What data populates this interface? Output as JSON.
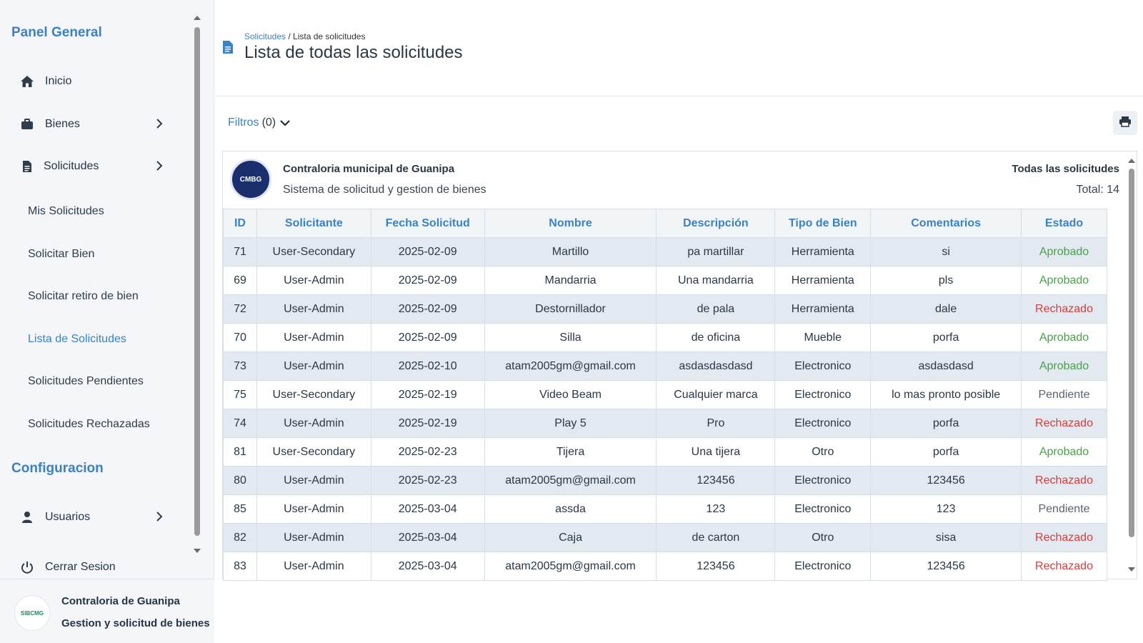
{
  "sidebar": {
    "panel_title": "Panel General",
    "items": [
      {
        "label": "Inicio",
        "icon": "home-icon"
      },
      {
        "label": "Bienes",
        "icon": "briefcase-icon"
      },
      {
        "label": "Solicitudes",
        "icon": "document-icon"
      }
    ],
    "sub_items": [
      "Mis Solicitudes",
      "Solicitar Bien",
      "Solicitar retiro de bien",
      "Lista de Solicitudes",
      "Solicitudes Pendientes",
      "Solicitudes Rechazadas"
    ],
    "active_sub": "Lista de Solicitudes",
    "config_title": "Configuracion",
    "usuarios_label": "Usuarios",
    "partial_label": "Cerrar Sesion",
    "footer": {
      "logo_text": "SIBCMG",
      "title": "Contraloria de Guanipa",
      "subtitle": "Gestion y solicitud de bienes"
    }
  },
  "header": {
    "breadcrumb_link": "Solicitudes",
    "breadcrumb_sep": " / ",
    "breadcrumb_current": "Lista de solicitudes",
    "title": "Lista de todas las solicitudes"
  },
  "toolbar": {
    "filters_label": "Filtros",
    "filters_count": "(0)"
  },
  "report": {
    "logo_text": "CMBG",
    "org_name": "Contraloria municipal de Guanipa",
    "org_subtitle": "Sistema de solicitud y gestion de bienes",
    "title": "Todas las solicitudes",
    "total": "Total: 14"
  },
  "table": {
    "columns": [
      "ID",
      "Solicitante",
      "Fecha Solicitud",
      "Nombre",
      "Descripción",
      "Tipo de Bien",
      "Comentarios",
      "Estado"
    ],
    "rows": [
      [
        "71",
        "User-Secondary",
        "2025-02-09",
        "Martillo",
        "pa martillar",
        "Herramienta",
        "si",
        "Aprobado"
      ],
      [
        "69",
        "User-Admin",
        "2025-02-09",
        "Mandarria",
        "Una mandarria",
        "Herramienta",
        "pls",
        "Aprobado"
      ],
      [
        "72",
        "User-Admin",
        "2025-02-09",
        "Destornillador",
        "de pala",
        "Herramienta",
        "dale",
        "Rechazado"
      ],
      [
        "70",
        "User-Admin",
        "2025-02-09",
        "Silla",
        "de oficina",
        "Mueble",
        "porfa",
        "Aprobado"
      ],
      [
        "73",
        "User-Admin",
        "2025-02-10",
        "atam2005gm@gmail.com",
        "asdasdasdasd",
        "Electronico",
        "asdasdasd",
        "Aprobado"
      ],
      [
        "75",
        "User-Secondary",
        "2025-02-19",
        "Video Beam",
        "Cualquier marca",
        "Electronico",
        "lo mas pronto posible",
        "Pendiente"
      ],
      [
        "74",
        "User-Admin",
        "2025-02-19",
        "Play 5",
        "Pro",
        "Electronico",
        "porfa",
        "Rechazado"
      ],
      [
        "81",
        "User-Secondary",
        "2025-02-23",
        "Tijera",
        "Una tijera",
        "Otro",
        "porfa",
        "Aprobado"
      ],
      [
        "80",
        "User-Admin",
        "2025-02-23",
        "atam2005gm@gmail.com",
        "123456",
        "Electronico",
        "123456",
        "Rechazado"
      ],
      [
        "85",
        "User-Admin",
        "2025-03-04",
        "assda",
        "123",
        "Electronico",
        "123",
        "Pendiente"
      ],
      [
        "82",
        "User-Admin",
        "2025-03-04",
        "Caja",
        "de carton",
        "Otro",
        "sisa",
        "Rechazado"
      ],
      [
        "83",
        "User-Admin",
        "2025-03-04",
        "atam2005gm@gmail.com",
        "123456",
        "Electronico",
        "123456",
        "Rechazado"
      ]
    ]
  },
  "colors": {
    "accent": "#3a82c4",
    "approved": "#4aa14a",
    "rejected": "#d2403d",
    "pending": "#5a6570"
  }
}
